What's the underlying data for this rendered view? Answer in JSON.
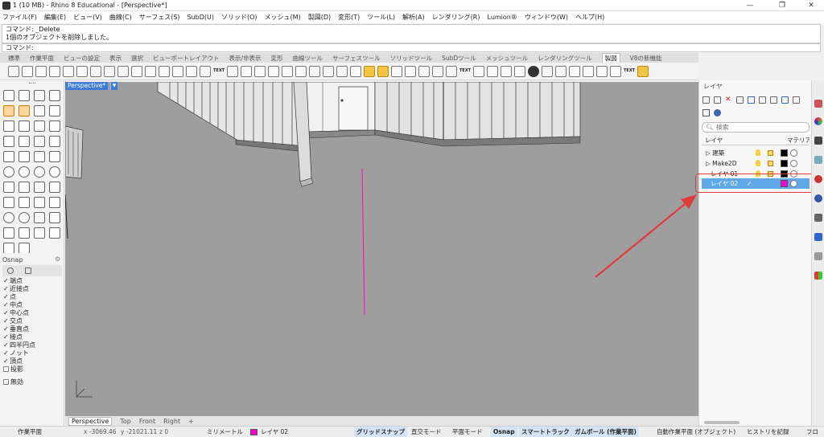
{
  "window": {
    "title": "1 (10 MB) - Rhino 8 Educational - [Perspective*]",
    "buttons": [
      "—",
      "❐",
      "✕"
    ]
  },
  "menu": [
    "ファイル(F)",
    "編集(E)",
    "ビュー(V)",
    "曲線(C)",
    "サーフェス(S)",
    "SubD(U)",
    "ソリッド(O)",
    "メッシュ(M)",
    "製図(D)",
    "変形(T)",
    "ツール(L)",
    "解析(A)",
    "レンダリング(R)",
    "Lumion®",
    "ウィンドウ(W)",
    "ヘルプ(H)"
  ],
  "command": {
    "history_line1": "コマンド: _Delete",
    "history_line2": "1個のオブジェクトを削除しました。",
    "prompt": "コマンド:"
  },
  "toolbar_tabs": [
    "標準",
    "作業平面",
    "ビューの設定",
    "表示",
    "選択",
    "ビューポートレイアウト",
    "表示/非表示",
    "変形",
    "曲線ツール",
    "サーフェスツール",
    "ソリッドツール",
    "SubDツール",
    "メッシュツール",
    "レンダリングツール",
    "製図",
    "V8の新機能"
  ],
  "toolbar_active_tab": "製図",
  "toolbar_text_icons": {
    "text1": "TEXT",
    "text2": "TEXT",
    "text3": "TEXT"
  },
  "osnap": {
    "title": "Osnap",
    "items": [
      {
        "label": "端点",
        "checked": true
      },
      {
        "label": "近接点",
        "checked": true
      },
      {
        "label": "点",
        "checked": true
      },
      {
        "label": "中点",
        "checked": true
      },
      {
        "label": "中心点",
        "checked": true
      },
      {
        "label": "交点",
        "checked": true
      },
      {
        "label": "垂直点",
        "checked": true
      },
      {
        "label": "接点",
        "checked": true
      },
      {
        "label": "四半円点",
        "checked": true
      },
      {
        "label": "ノット",
        "checked": true
      },
      {
        "label": "頂点",
        "checked": true
      },
      {
        "label": "投影",
        "checked": false
      },
      {
        "label": "無効",
        "checked": false
      }
    ]
  },
  "viewport": {
    "label": "Perspective*",
    "tabs": [
      "Perspective",
      "Top",
      "Front",
      "Right",
      "+"
    ],
    "active_tab": "Perspective"
  },
  "layers": {
    "title": "レイヤ",
    "search_placeholder": "検索",
    "col_layer": "レイヤ",
    "col_material": "マテリアル",
    "rows": [
      {
        "name": "建築",
        "expand": "▷",
        "color": "#000000",
        "current": false
      },
      {
        "name": "Make2D",
        "expand": "▷",
        "color": "#000000",
        "current": false
      },
      {
        "name": "レイヤ 01",
        "expand": "",
        "color": "#000000",
        "current": false
      },
      {
        "name": "レイヤ 02",
        "expand": "",
        "color": "#ff00cc",
        "current": true,
        "check": "✓"
      }
    ]
  },
  "status": {
    "cplane": "作業平面",
    "x": "x -3069.46",
    "y": "y -21021.11",
    "z": "z 0",
    "units": "ミリメートル",
    "layer": "レイヤ 02",
    "layer_color": "#ff00cc",
    "grid_snap": "グリッドスナップ",
    "ortho": "直交モード",
    "planar": "平面モード",
    "osnap": "Osnap",
    "smart_track": "スマートトラック",
    "gumball": "ガムボール (作業平面)",
    "auto_cplane": "自動作業平面 (オブジェクト)",
    "history": "ヒストリを記録",
    "filter": "フロ"
  },
  "colors": {
    "accent": "#3d7bd6",
    "selected_layer": "#5fa9e6",
    "annotation": "#e23b3b",
    "curve": "#ff00cc"
  }
}
